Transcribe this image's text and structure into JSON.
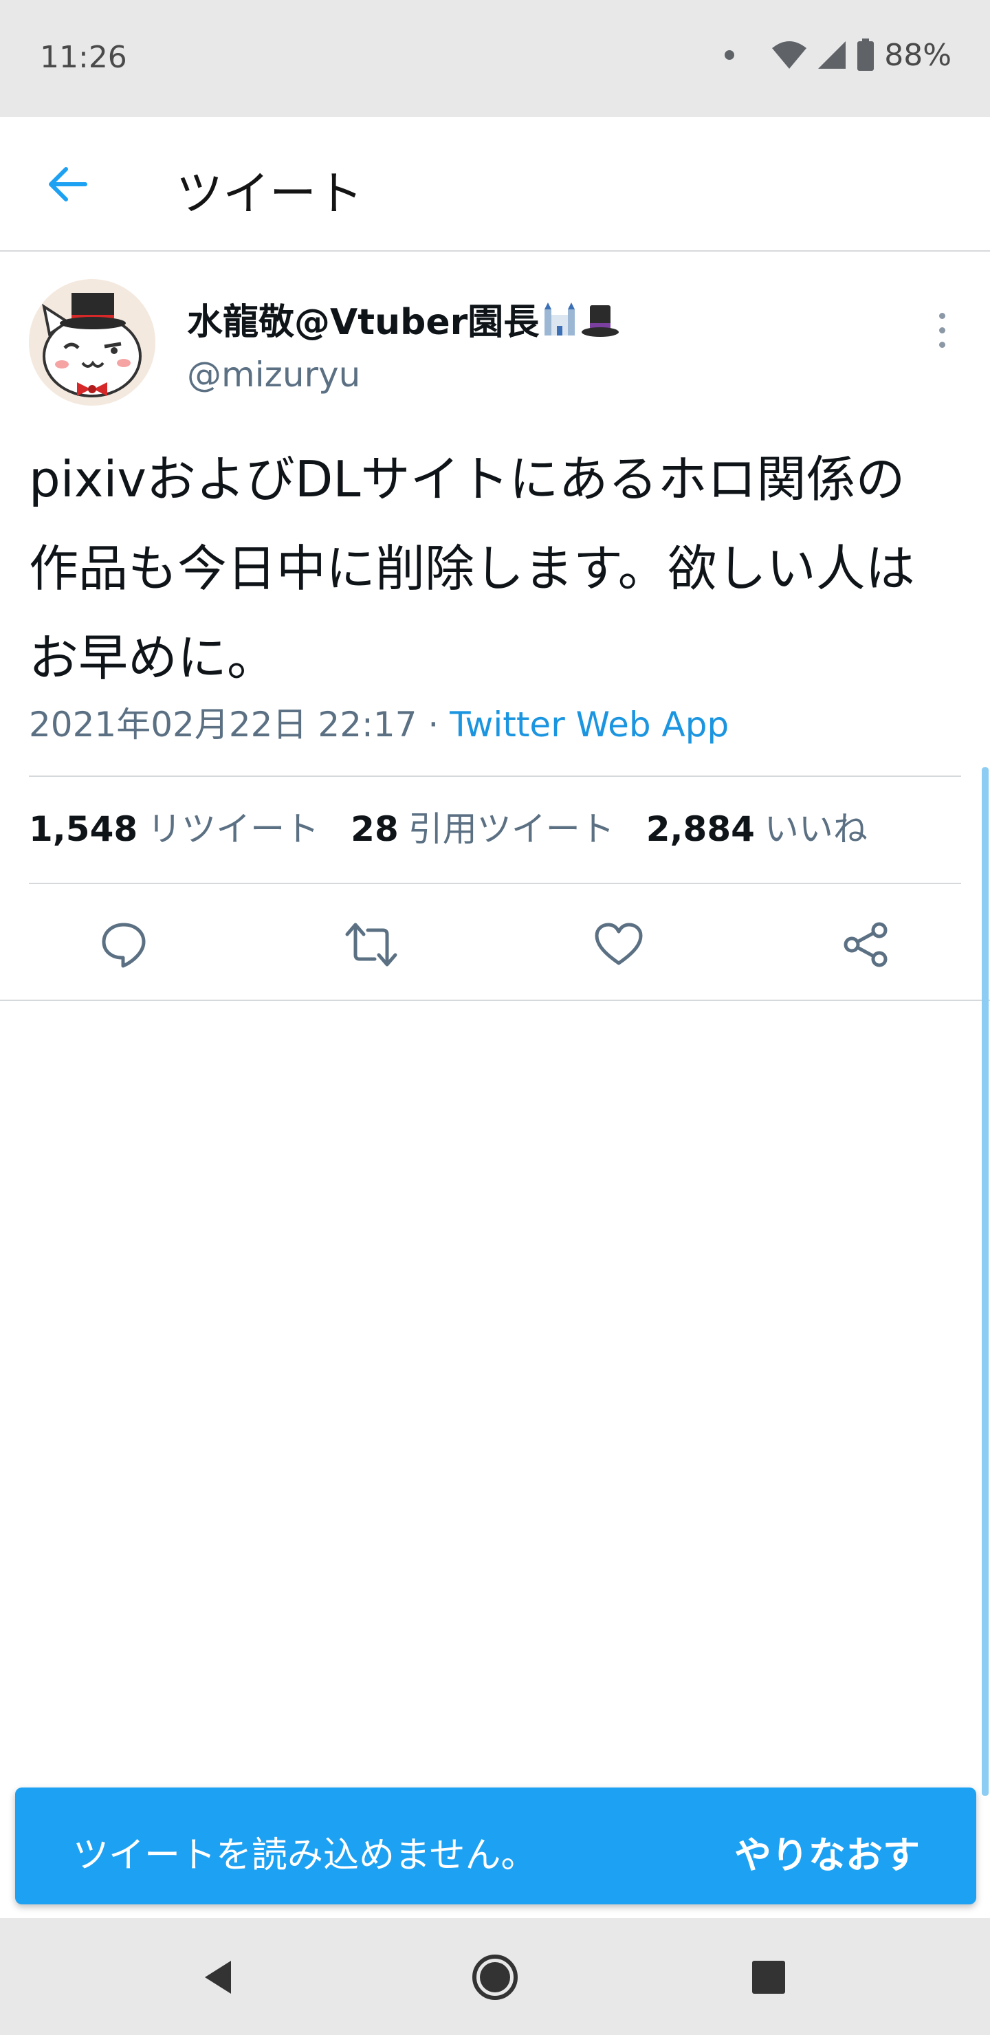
{
  "status_bar": {
    "time": "11:26",
    "battery_percent": "88%",
    "icons": [
      "notification-dot-icon",
      "wifi-icon",
      "cell-signal-icon",
      "battery-icon"
    ]
  },
  "app_bar": {
    "title": "ツイート",
    "back_icon": "arrow-left-icon"
  },
  "tweet": {
    "author": {
      "display_name": "水龍敬@Vtuber園長",
      "emojis": [
        "castle-emoji",
        "top-hat-emoji"
      ],
      "handle": "@mizuryu"
    },
    "text": "pixivおよびDLサイトにあるホロ関係の作品も今日中に削除します。欲しい人はお早めに。",
    "timestamp": "2021年02月22日 22:17",
    "separator": " · ",
    "source_app": "Twitter Web App",
    "stats": [
      {
        "count": "1,548",
        "label": "リツイート"
      },
      {
        "count": "28",
        "label": "引用ツイート"
      },
      {
        "count": "2,884",
        "label": "いいね"
      }
    ],
    "actions": [
      "reply-icon",
      "retweet-icon",
      "like-icon",
      "share-icon"
    ]
  },
  "snackbar": {
    "message": "ツイートを読み込めません。",
    "action_label": "やりなおす"
  },
  "colors": {
    "accent": "#1da1f2",
    "link": "#1b95e0",
    "secondary_text": "#5b7083",
    "system_bar": "#e8e8e8"
  },
  "nav_bar": {
    "buttons": [
      "back-triangle-icon",
      "home-circle-icon",
      "recents-square-icon"
    ]
  }
}
